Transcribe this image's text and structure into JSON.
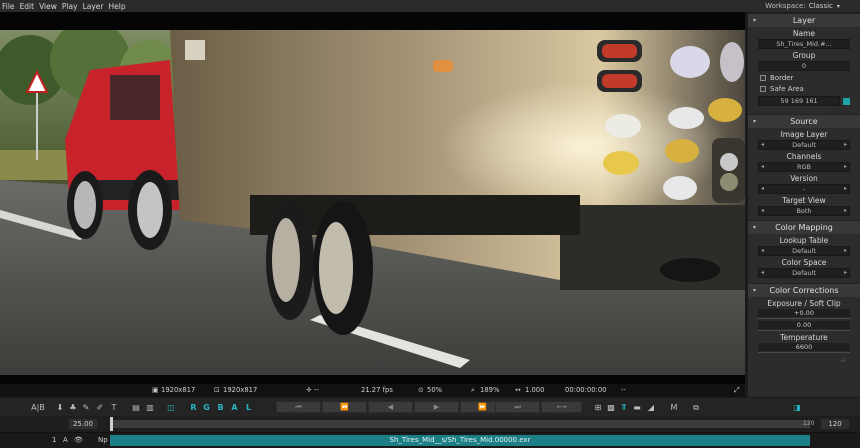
{
  "menu": [
    "File",
    "Edit",
    "View",
    "Play",
    "Layer",
    "Help"
  ],
  "workspace": {
    "label": "Workspace:",
    "value": "Classic"
  },
  "viewer_status": {
    "size_a": "1920x817",
    "size_b": "1920x817",
    "pos": "--",
    "fps": "21.27 fps",
    "zoom_a": "50%",
    "zoom_b": "189%",
    "ratio": "1.000",
    "timecode": "00:00:00:00",
    "extra": "--"
  },
  "panel": {
    "layer": {
      "title": "Layer",
      "name_label": "Name",
      "name_value": "Sh_Tires_Mid.#...",
      "group_label": "Group",
      "group_value": "0",
      "border": "Border",
      "safe_area": "Safe Area",
      "color_value": "59 169 161",
      "accent": "#1ea3a8"
    },
    "source": {
      "title": "Source",
      "image_layer": "Image Layer",
      "image_layer_value": "Default",
      "channels": "Channels",
      "channels_value": "RGB",
      "version": "Version",
      "version_value": "-",
      "target_view": "Target View",
      "target_view_value": "Both"
    },
    "color_mapping": {
      "title": "Color Mapping",
      "lut": "Lookup Table",
      "lut_value": "Default",
      "color_space": "Color Space",
      "color_space_value": "Default"
    },
    "color_corrections": {
      "title": "Color Corrections",
      "exposure": "Exposure / Soft Clip",
      "exposure_value": "+0.00",
      "soft_clip_value": "0.00",
      "temperature": "Temperature",
      "temperature_value": "6600"
    }
  },
  "toolbar": {
    "ab": "A|B",
    "channels": [
      "R",
      "G",
      "B",
      "A",
      "L"
    ],
    "m": "M"
  },
  "timeline": {
    "current": "25.00",
    "end_marker": "120",
    "end_value": "120"
  },
  "layer_row": {
    "index": "1",
    "a": "A",
    "np": "Np",
    "clip": "Sh_Tires_Mid__s/Sh_Tires_Mid.00000.exr"
  }
}
